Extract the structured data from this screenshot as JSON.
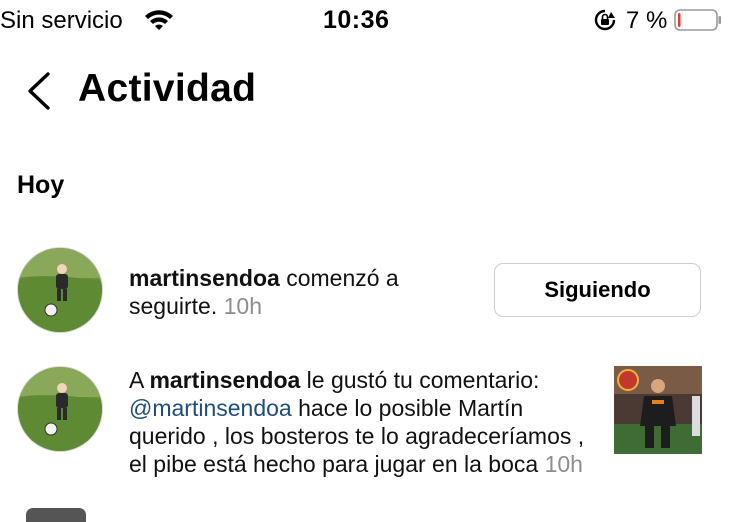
{
  "status_bar": {
    "carrier": "Sin servicio",
    "time": "10:36",
    "battery_percent": "7 %",
    "battery_level": 0.07,
    "battery_color": "#e53935"
  },
  "header": {
    "title": "Actividad"
  },
  "sections": [
    {
      "title": "Hoy",
      "items": [
        {
          "username": "martinsendoa",
          "text_before": "",
          "text_after": " comenzó a seguirte.",
          "time": "10h",
          "button_label": "Siguiendo"
        },
        {
          "username": "martinsendoa",
          "text_before": "A ",
          "text_after": " le gustó tu comentario: ",
          "mention": "@martinsendoa",
          "comment": " hace lo posible Martín querido , los bosteros te lo agradeceríamos , el pibe está hecho para jugar en la boca",
          "time": "10h"
        }
      ]
    }
  ],
  "colors": {
    "mention": "#1f4d7a",
    "timestamp": "#8e8e8e",
    "button_border": "#cfcfcf"
  }
}
